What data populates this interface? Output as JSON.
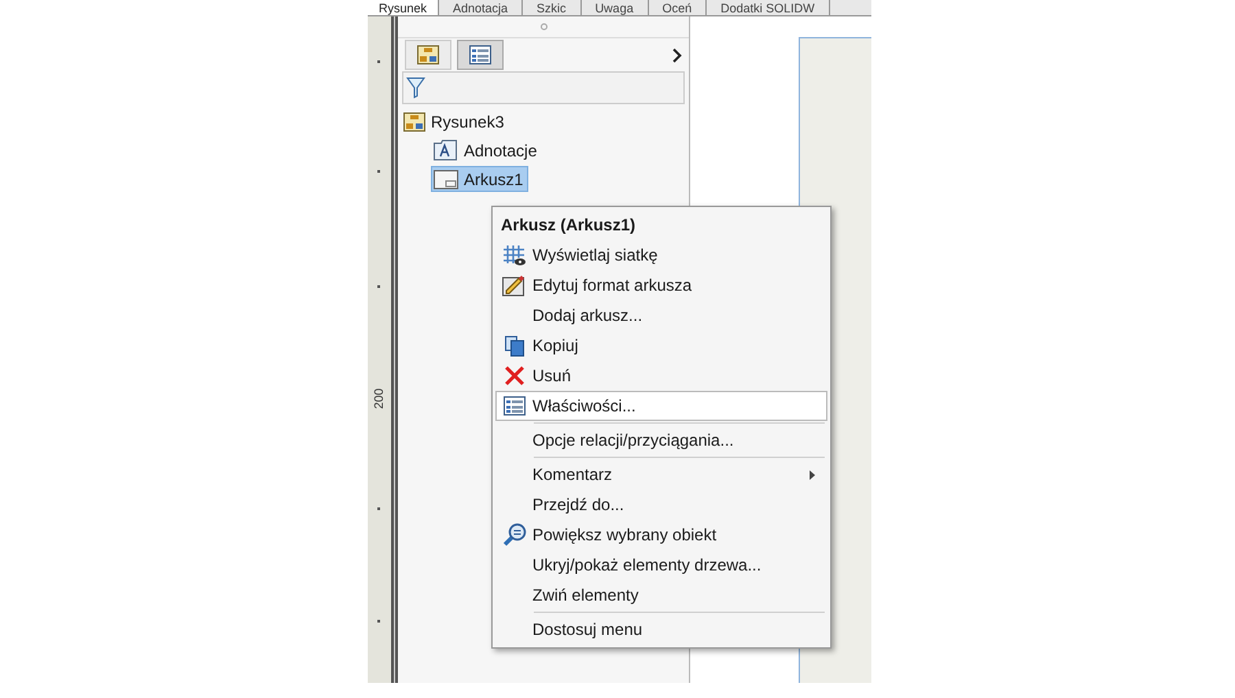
{
  "tabs": [
    {
      "label": "Rysunek",
      "selected": true
    },
    {
      "label": "Adnotacja",
      "selected": false
    },
    {
      "label": "Szkic",
      "selected": false
    },
    {
      "label": "Uwaga",
      "selected": false
    },
    {
      "label": "Oceń",
      "selected": false
    },
    {
      "label": "Dodatki SOLIDW",
      "selected": false
    }
  ],
  "ruler": {
    "label": "200"
  },
  "panel_tabs": [
    {
      "kind": "tree",
      "selected": false
    },
    {
      "kind": "properties",
      "selected": true
    }
  ],
  "tree": {
    "name": "Rysunek3",
    "kind": "drawing",
    "selected": false,
    "children": [
      {
        "name": "Adnotacje",
        "kind": "annotations",
        "selected": false
      },
      {
        "name": "Arkusz1",
        "kind": "sheet",
        "selected": true
      }
    ]
  },
  "context_menu": {
    "title": "Arkusz (Arkusz1)",
    "items": [
      {
        "label": "Wyświetlaj siatkę",
        "kind": "grid",
        "highlighted": false,
        "submenu": false
      },
      {
        "label": "Edytuj format arkusza",
        "kind": "edit",
        "highlighted": false,
        "submenu": false
      },
      {
        "label": "Dodaj arkusz...",
        "kind": "plain",
        "highlighted": false,
        "submenu": false
      },
      {
        "label": "Kopiuj",
        "kind": "copy",
        "highlighted": false,
        "submenu": false
      },
      {
        "label": "Usuń",
        "kind": "delete",
        "highlighted": false,
        "submenu": false
      },
      {
        "label": "Właściwości...",
        "kind": "properties",
        "highlighted": true,
        "submenu": false
      },
      {
        "kind": "separator"
      },
      {
        "label": "Opcje relacji/przyciągania...",
        "kind": "plain",
        "highlighted": false,
        "submenu": false
      },
      {
        "kind": "separator"
      },
      {
        "label": "Komentarz",
        "kind": "plain",
        "highlighted": false,
        "submenu": true
      },
      {
        "label": "Przejdź do...",
        "kind": "plain",
        "highlighted": false,
        "submenu": false
      },
      {
        "label": "Powiększ wybrany obiekt",
        "kind": "zoom",
        "highlighted": false,
        "submenu": false
      },
      {
        "label": "Ukryj/pokaż elementy drzewa...",
        "kind": "plain",
        "highlighted": false,
        "submenu": false
      },
      {
        "label": "Zwiń elementy",
        "kind": "plain",
        "highlighted": false,
        "submenu": false
      },
      {
        "kind": "separator"
      },
      {
        "label": "Dostosuj menu",
        "kind": "plain",
        "highlighted": false,
        "submenu": false
      }
    ]
  }
}
